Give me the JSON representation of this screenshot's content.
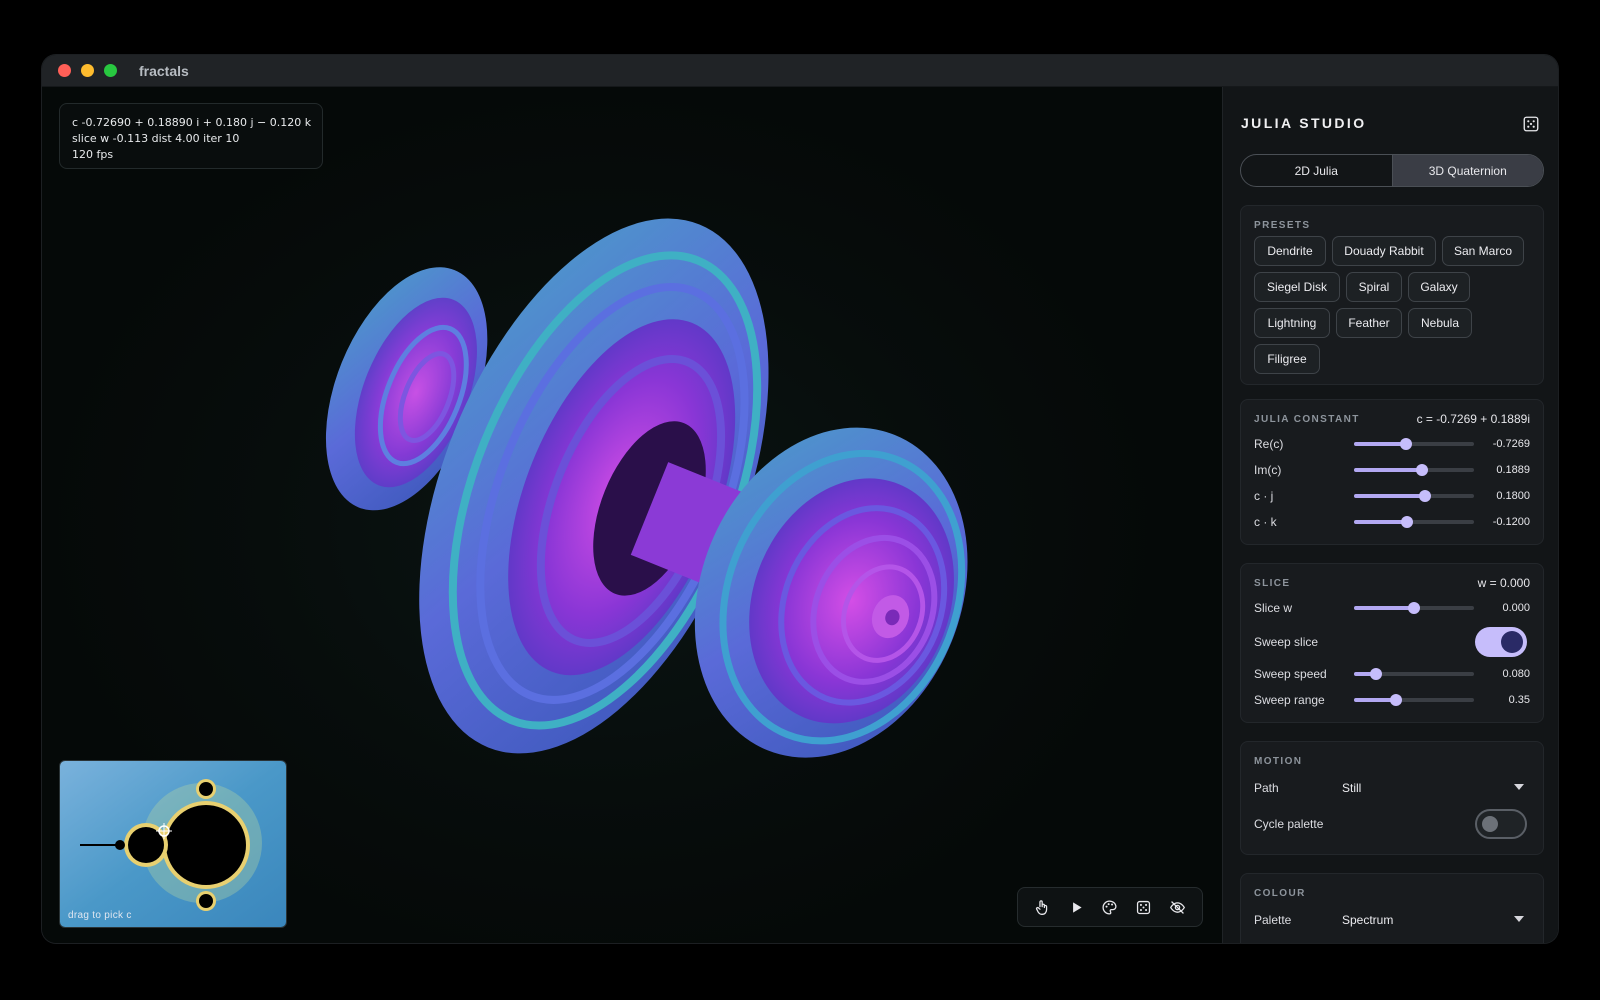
{
  "window": {
    "title": "fractals"
  },
  "hud": {
    "line1": "c  -0.72690  + 0.18890 i  + 0.180 j  − 0.120 k",
    "line2": "slice w  -0.113   dist  4.00   iter  10",
    "line3": "120 fps"
  },
  "minimap": {
    "hint": "drag to pick c",
    "cursor_re": -0.7269,
    "cursor_im": 0.1889
  },
  "toolbar": {
    "icons": [
      "pointer-icon",
      "play-icon",
      "palette-icon",
      "dice-icon",
      "eye-off-icon"
    ]
  },
  "panel": {
    "app_name": "JULIA STUDIO",
    "mode_tabs": [
      {
        "label": "2D Julia",
        "active": false
      },
      {
        "label": "3D Quaternion",
        "active": true
      }
    ],
    "presets": {
      "title": "PRESETS",
      "items": [
        "Dendrite",
        "Douady Rabbit",
        "San Marco",
        "Siegel Disk",
        "Spiral",
        "Galaxy",
        "Lightning",
        "Feather",
        "Nebula",
        "Filigree"
      ]
    },
    "julia": {
      "title": "JULIA CONSTANT",
      "value": "c = -0.7269 + 0.1889i",
      "rows": [
        {
          "label": "Re(c)",
          "value": "-0.7269",
          "level": 0.43
        },
        {
          "label": "Im(c)",
          "value": "0.1889",
          "level": 0.57
        },
        {
          "label": "c · j",
          "value": "0.1800",
          "level": 0.59
        },
        {
          "label": "c · k",
          "value": "-0.1200",
          "level": 0.44
        }
      ]
    },
    "slice": {
      "title": "SLICE",
      "value": "w = 0.000",
      "slice_w": {
        "label": "Slice w",
        "value": "0.000",
        "level": 0.5
      },
      "sweep": {
        "label": "Sweep slice",
        "on": true
      },
      "speed": {
        "label": "Sweep speed",
        "value": "0.080",
        "level": 0.18
      },
      "range": {
        "label": "Sweep range",
        "value": "0.35",
        "level": 0.35
      }
    },
    "motion": {
      "title": "MOTION",
      "path_label": "Path",
      "path_value": "Still",
      "cycle_label": "Cycle palette",
      "cycle_on": false
    },
    "colour": {
      "title": "COLOUR",
      "palette_label": "Palette",
      "palette_value": "Spectrum"
    }
  },
  "colors": {
    "accent": "#c6bdfb",
    "panel_bg": "#121517",
    "viewport_bg": "#070d0c"
  }
}
